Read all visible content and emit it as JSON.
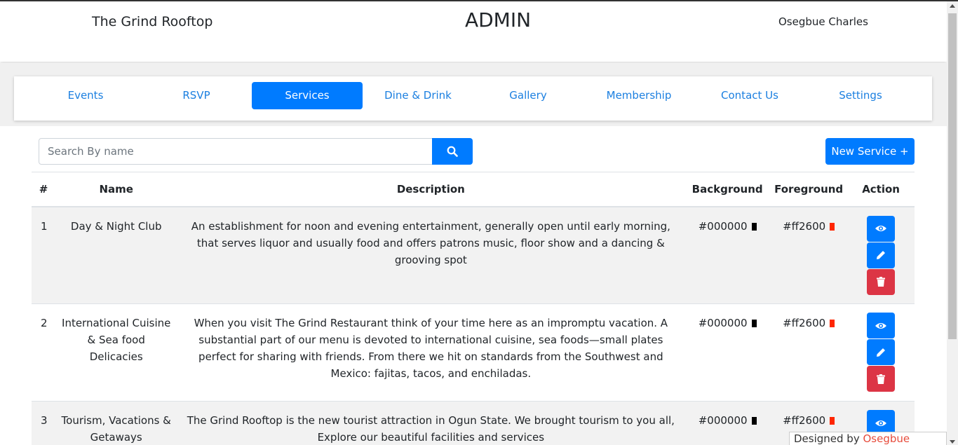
{
  "header": {
    "brand": "The Grind Rooftop",
    "title": "ADMIN",
    "user": "Osegbue Charles"
  },
  "nav": {
    "items": [
      {
        "label": "Events"
      },
      {
        "label": "RSVP"
      },
      {
        "label": "Services",
        "active": true
      },
      {
        "label": "Dine & Drink"
      },
      {
        "label": "Gallery"
      },
      {
        "label": "Membership"
      },
      {
        "label": "Contact Us"
      },
      {
        "label": "Settings"
      }
    ]
  },
  "search": {
    "placeholder": "Search By name",
    "icon": "search-icon"
  },
  "new_service_label": "New Service +",
  "table": {
    "headers": [
      "#",
      "Name",
      "Description",
      "Background",
      "Foreground",
      "Action"
    ],
    "rows": [
      {
        "num": "1",
        "name": "Day & Night Club",
        "description": "An establishment for noon and evening entertainment, generally open until early morning, that serves liquor and usually food and offers patrons music, floor show and a dancing & grooving spot",
        "background": "#000000",
        "foreground": "#ff2600"
      },
      {
        "num": "2",
        "name": "International Cuisine & Sea food Delicacies",
        "description": "When you visit The Grind Restaurant think of your time here as an impromptu vacation. A substantial part of our menu is devoted to international cuisine, sea foods—small plates perfect for sharing with friends. From there we hit on standards from the Southwest and Mexico: fajitas, tacos, and enchiladas.",
        "background": "#000000",
        "foreground": "#ff2600"
      },
      {
        "num": "3",
        "name": "Tourism, Vacations & Getaways",
        "description": "The Grind Rooftop is the new tourist attraction in Ogun State. We brought tourism to you all, Explore our beautiful facilities and services",
        "background": "#000000",
        "foreground": "#ff2600"
      }
    ]
  },
  "credit": {
    "by": "Designed by ",
    "name": "Osegbue Charles"
  },
  "colors": {
    "primary": "#007bff",
    "danger": "#dc3545"
  }
}
